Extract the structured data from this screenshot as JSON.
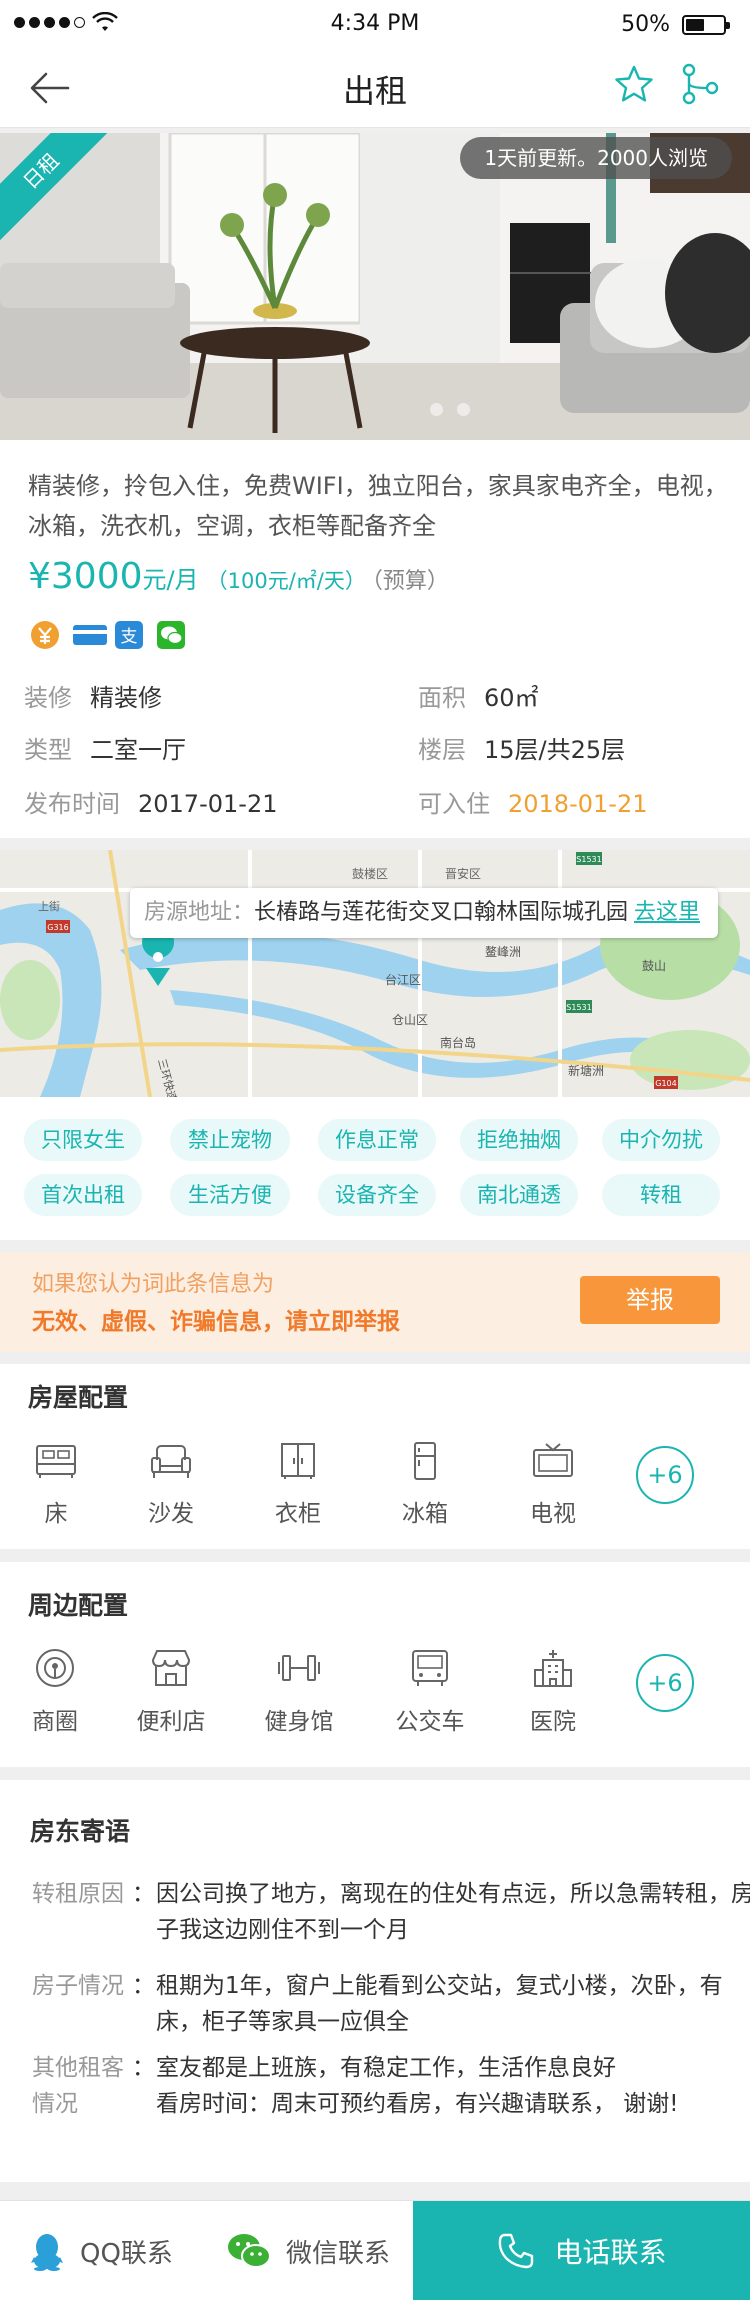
{
  "status": {
    "time": "4:34 PM",
    "battery": "50%"
  },
  "nav": {
    "title": "出租"
  },
  "gallery": {
    "badge": "日租",
    "update": "1天前更新。2000人浏览"
  },
  "listing": {
    "description": "精装修，拎包入住，免费WIFI，独立阳台，家具家电齐全，电视，冰箱，洗衣机，空调，衣柜等配备齐全",
    "price_symbol": "¥",
    "price_value": "3000",
    "price_unit": "元/月",
    "price_daily": "（100元/㎡/天）",
    "price_note": "（预算）",
    "payment_icons": [
      "yuan-icon",
      "bank-card-icon",
      "alipay-icon",
      "wechat-pay-icon"
    ],
    "details": [
      {
        "key": "装修",
        "value": "精装修"
      },
      {
        "key": "面积",
        "value": "60㎡"
      },
      {
        "key": "类型",
        "value": "二室一厅"
      },
      {
        "key": "楼层",
        "value": "15层/共25层"
      },
      {
        "key": "发布时间",
        "value": "2017-01-21"
      },
      {
        "key": "可入住",
        "value": "2018-01-21"
      }
    ]
  },
  "map": {
    "address_label": "房源地址：",
    "address": "长椿路与莲花街交叉口翰林国际城孔园",
    "go_label": "去这里",
    "places": [
      "鼓楼区",
      "晋安区",
      "台江区",
      "仓山区",
      "南台岛",
      "鼓山",
      "新塘洲",
      "鳌峰洲",
      "上街",
      "S1531",
      "G316",
      "S1531",
      "G104",
      "三环快速"
    ]
  },
  "tags": [
    "只限女生",
    "禁止宠物",
    "作息正常",
    "拒绝抽烟",
    "中介勿扰",
    "首次出租",
    "生活方便",
    "设备齐全",
    "南北通透",
    "转租"
  ],
  "report": {
    "line1": "如果您认为词此条信息为",
    "line2": "无效、虚假、诈骗信息，请立即举报",
    "button": "举报"
  },
  "house_config": {
    "title": "房屋配置",
    "items": [
      {
        "label": "床",
        "icon": "bed-icon"
      },
      {
        "label": "沙发",
        "icon": "sofa-icon"
      },
      {
        "label": "衣柜",
        "icon": "wardrobe-icon"
      },
      {
        "label": "冰箱",
        "icon": "fridge-icon"
      },
      {
        "label": "电视",
        "icon": "tv-icon"
      }
    ],
    "more": "+6"
  },
  "nearby_config": {
    "title": "周边配置",
    "items": [
      {
        "label": "商圈",
        "icon": "business-district-icon"
      },
      {
        "label": "便利店",
        "icon": "store-icon"
      },
      {
        "label": "健身馆",
        "icon": "dumbbell-icon"
      },
      {
        "label": "公交车",
        "icon": "bus-icon"
      },
      {
        "label": "医院",
        "icon": "hospital-icon"
      }
    ],
    "more": "+6"
  },
  "landlord": {
    "title": "房东寄语",
    "rows": [
      {
        "key": "转租原因",
        "colon": "：",
        "value": "因公司换了地方，离现在的住处有点远，所以急需转租，房子我这边刚住不到一个月"
      },
      {
        "key": "房子情况",
        "colon": "：",
        "value": "租期为1年，窗户上能看到公交站，复式小楼，次卧，有床，柜子等家具一应俱全"
      },
      {
        "key": "其他租客情况",
        "colon": "：",
        "value": "室友都是上班族，有稳定工作，生活作息良好\n看房时间：周末可预约看房，有兴趣请联系， 谢谢!"
      }
    ]
  },
  "bottom": {
    "qq": "QQ联系",
    "wechat": "微信联系",
    "phone": "电话联系"
  },
  "colors": {
    "accent": "#1ab5b0",
    "orange": "#f7963a"
  }
}
